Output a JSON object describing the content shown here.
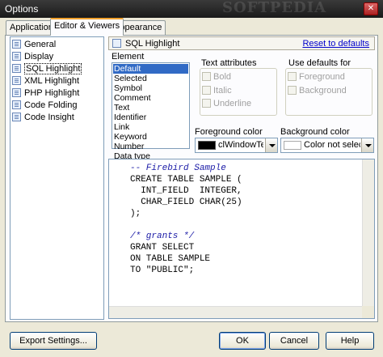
{
  "window": {
    "title": "Options",
    "watermark": "SOFTPEDIA"
  },
  "tabs": [
    {
      "label": "Application"
    },
    {
      "label": "Editor & Viewers"
    },
    {
      "label": "Appearance"
    }
  ],
  "tree": {
    "items": [
      {
        "label": "General",
        "icon": "page-icon"
      },
      {
        "label": "Display",
        "icon": "page-icon"
      },
      {
        "label": "SQL Highlight",
        "icon": "page-icon",
        "selected": true
      },
      {
        "label": "XML Highlight",
        "icon": "page-icon"
      },
      {
        "label": "PHP Highlight",
        "icon": "page-icon"
      },
      {
        "label": "Code Folding",
        "icon": "page-icon"
      },
      {
        "label": "Code Insight",
        "icon": "page-icon"
      }
    ]
  },
  "header": {
    "title": "SQL Highlight",
    "reset_link": "Reset to defaults"
  },
  "element": {
    "label": "Element",
    "items": [
      "Default",
      "Selected",
      "Symbol",
      "Comment",
      "Text",
      "Identifier",
      "Link",
      "Keyword",
      "Number",
      "Data type"
    ],
    "selected": "Default"
  },
  "text_attributes": {
    "label": "Text attributes",
    "bold": "Bold",
    "italic": "Italic",
    "underline": "Underline"
  },
  "use_defaults": {
    "label": "Use defaults for",
    "foreground": "Foreground",
    "background": "Background"
  },
  "foreground_color": {
    "label": "Foreground color",
    "value": "clWindowText",
    "swatch": "#000000"
  },
  "background_color": {
    "label": "Background color",
    "value": "Color not selecte",
    "swatch": "#ffffff"
  },
  "preview": {
    "lines": [
      "-- Firebird Sample",
      "CREATE TABLE SAMPLE (",
      "  INT_FIELD  INTEGER,",
      "  CHAR_FIELD CHAR(25)",
      ");",
      "",
      "/* grants */",
      "GRANT SELECT",
      "ON TABLE SAMPLE",
      "TO \"PUBLIC\";"
    ]
  },
  "buttons": {
    "export": "Export Settings...",
    "ok": "OK",
    "cancel": "Cancel",
    "help": "Help"
  },
  "colors": {
    "link": "#0000cc",
    "selection": "#316ac5",
    "comment": "#1a1aa6"
  }
}
